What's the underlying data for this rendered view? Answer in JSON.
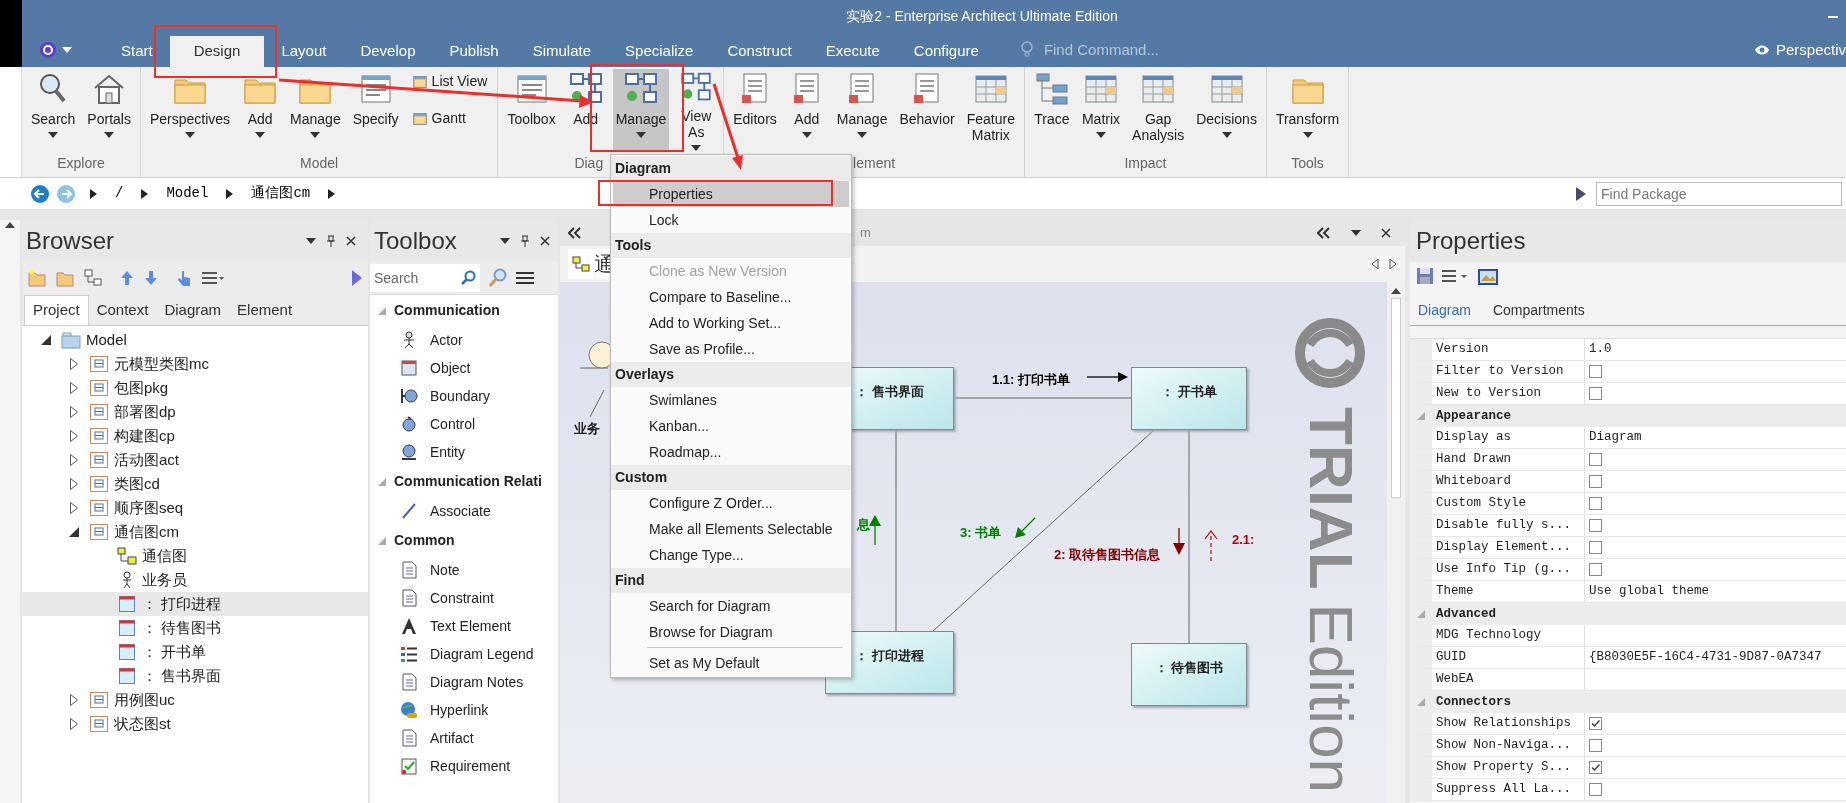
{
  "window": {
    "title": "实验2 - Enterprise Architect Ultimate Edition"
  },
  "ribbon_tabs": [
    {
      "label": "Start",
      "selected": false
    },
    {
      "label": "Design",
      "selected": true
    },
    {
      "label": "Layout",
      "selected": false
    },
    {
      "label": "Develop",
      "selected": false
    },
    {
      "label": "Publish",
      "selected": false
    },
    {
      "label": "Simulate",
      "selected": false
    },
    {
      "label": "Specialize",
      "selected": false
    },
    {
      "label": "Construct",
      "selected": false
    },
    {
      "label": "Execute",
      "selected": false
    },
    {
      "label": "Configure",
      "selected": false
    }
  ],
  "find_command": {
    "placeholder": "Find Command..."
  },
  "perspective": {
    "label": "Perspectiv"
  },
  "ribbon_groups": [
    {
      "label": "Explore",
      "buttons": [
        {
          "label": "Search",
          "kind": "large",
          "dropdown": true,
          "selected": false
        },
        {
          "label": "Portals",
          "kind": "large",
          "dropdown": true,
          "selected": false
        }
      ]
    },
    {
      "label": "Model",
      "buttons": [
        {
          "label": "Perspectives",
          "kind": "large",
          "dropdown": true,
          "selected": false
        },
        {
          "label": "Add",
          "kind": "large",
          "dropdown": true,
          "selected": false
        },
        {
          "label": "Manage",
          "kind": "large",
          "dropdown": true,
          "selected": false
        },
        {
          "label": "Specify",
          "kind": "large",
          "dropdown": false,
          "selected": false
        },
        {
          "label": "List View",
          "kind": "small",
          "dropdown": false,
          "selected": false
        },
        {
          "label": "Gantt",
          "kind": "small",
          "dropdown": false,
          "selected": false
        }
      ]
    },
    {
      "label": "Diag",
      "buttons": [
        {
          "label": "Toolbox",
          "kind": "large",
          "dropdown": false,
          "selected": false
        },
        {
          "label": "Add",
          "kind": "large",
          "dropdown": false,
          "selected": false
        },
        {
          "label": "Manage",
          "kind": "large",
          "dropdown": true,
          "selected": true
        },
        {
          "label": "View As",
          "kind": "large",
          "dropdown": true,
          "selected": false
        }
      ]
    },
    {
      "label": "lement",
      "buttons": [
        {
          "label": "Editors",
          "kind": "large",
          "dropdown": false,
          "selected": false
        },
        {
          "label": "Add",
          "kind": "large",
          "dropdown": true,
          "selected": false
        },
        {
          "label": "Manage",
          "kind": "large",
          "dropdown": true,
          "selected": false
        },
        {
          "label": "Behavior",
          "kind": "large",
          "dropdown": false,
          "selected": false
        },
        {
          "label": "Feature Matrix",
          "kind": "large",
          "dropdown": false,
          "selected": false
        }
      ]
    },
    {
      "label": "Impact",
      "buttons": [
        {
          "label": "Trace",
          "kind": "large",
          "dropdown": false,
          "selected": false
        },
        {
          "label": "Matrix",
          "kind": "large",
          "dropdown": true,
          "selected": false
        },
        {
          "label": "Gap Analysis",
          "kind": "large",
          "dropdown": false,
          "selected": false
        },
        {
          "label": "Decisions",
          "kind": "large",
          "dropdown": true,
          "selected": false
        }
      ]
    },
    {
      "label": "Tools",
      "buttons": [
        {
          "label": "Transform",
          "kind": "large",
          "dropdown": true,
          "selected": false
        }
      ]
    }
  ],
  "breadcrumb": [
    "/",
    "Model",
    "通信图cm"
  ],
  "find_package": {
    "placeholder": "Find Package"
  },
  "browser": {
    "title": "Browser",
    "tabs": [
      {
        "label": "Project",
        "selected": true
      },
      {
        "label": "Context",
        "selected": false
      },
      {
        "label": "Diagram",
        "selected": false
      },
      {
        "label": "Element",
        "selected": false
      }
    ],
    "tree": [
      {
        "label": "Model",
        "kind": "model",
        "expanded": true,
        "selected": false,
        "children": [
          {
            "label": "元模型类图mc",
            "kind": "package",
            "expanded": false,
            "selected": false
          },
          {
            "label": "包图pkg",
            "kind": "package",
            "expanded": false,
            "selected": false
          },
          {
            "label": "部署图dp",
            "kind": "package",
            "expanded": false,
            "selected": false
          },
          {
            "label": "构建图cp",
            "kind": "package",
            "expanded": false,
            "selected": false
          },
          {
            "label": "活动图act",
            "kind": "package",
            "expanded": false,
            "selected": false
          },
          {
            "label": "类图cd",
            "kind": "package",
            "expanded": false,
            "selected": false
          },
          {
            "label": "顺序图seq",
            "kind": "package",
            "expanded": false,
            "selected": false
          },
          {
            "label": "通信图cm",
            "kind": "package",
            "expanded": true,
            "selected": false,
            "children": [
              {
                "label": "通信图",
                "kind": "diagram",
                "selected": false
              },
              {
                "label": "业务员",
                "kind": "actor",
                "selected": false
              },
              {
                "label": "： 打印进程",
                "kind": "object",
                "selected": true
              },
              {
                "label": "： 待售图书",
                "kind": "object",
                "selected": false
              },
              {
                "label": "： 开书单",
                "kind": "object",
                "selected": false
              },
              {
                "label": "： 售书界面",
                "kind": "object",
                "selected": false
              }
            ]
          },
          {
            "label": "用例图uc",
            "kind": "package",
            "expanded": false,
            "selected": false
          },
          {
            "label": "状态图st",
            "kind": "package",
            "expanded": false,
            "selected": false
          }
        ]
      }
    ]
  },
  "toolbox": {
    "title": "Toolbox",
    "search": {
      "placeholder": "Search"
    },
    "sections": [
      {
        "title": "Communication",
        "expanded": true,
        "items": [
          "Actor",
          "Object",
          "Boundary",
          "Control",
          "Entity"
        ]
      },
      {
        "title": "Communication Relati",
        "expanded": true,
        "items": [
          "Associate"
        ]
      },
      {
        "title": "Common",
        "expanded": true,
        "items": [
          "Note",
          "Constraint",
          "Text Element",
          "Diagram Legend",
          "Diagram Notes",
          "Hyperlink",
          "Artifact",
          "Requirement"
        ]
      }
    ]
  },
  "diagram": {
    "title": "m",
    "tab": "通",
    "actor": "业务",
    "nodes": [
      {
        "label": "： 售书界面"
      },
      {
        "label": "： 开书单"
      },
      {
        "label": "： 打印进程"
      },
      {
        "label": "： 待售图书"
      }
    ],
    "messages": [
      {
        "label": "1.1: 打印书单",
        "color": "#000000"
      },
      {
        "label": "3: 书单",
        "color": "#008000"
      },
      {
        "label": "2: 取待售图书信息",
        "color": "#800000"
      },
      {
        "label": "2.1:",
        "color": "#c00000"
      },
      {
        "label": "息",
        "color": "#008000"
      }
    ],
    "watermark": [
      "TRIAL",
      "Edition"
    ]
  },
  "menu": {
    "sections": [
      {
        "title": "Diagram",
        "items": [
          {
            "label": "Properties",
            "selected": true,
            "disabled": false
          },
          {
            "label": "Lock",
            "selected": false,
            "disabled": false
          }
        ]
      },
      {
        "title": "Tools",
        "items": [
          {
            "label": "Clone as New Version",
            "selected": false,
            "disabled": true
          },
          {
            "label": "Compare to Baseline...",
            "selected": false,
            "disabled": false
          },
          {
            "label": "Add to Working Set...",
            "selected": false,
            "disabled": false
          },
          {
            "label": "Save as Profile...",
            "selected": false,
            "disabled": false
          }
        ]
      },
      {
        "title": "Overlays",
        "items": [
          {
            "label": "Swimlanes",
            "selected": false,
            "disabled": false
          },
          {
            "label": "Kanban...",
            "selected": false,
            "disabled": false
          },
          {
            "label": "Roadmap...",
            "selected": false,
            "disabled": false
          }
        ]
      },
      {
        "title": "Custom",
        "items": [
          {
            "label": "Configure Z Order...",
            "selected": false,
            "disabled": false
          },
          {
            "label": "Make all Elements Selectable",
            "selected": false,
            "disabled": false
          },
          {
            "label": "Change Type...",
            "selected": false,
            "disabled": false
          }
        ]
      },
      {
        "title": "Find",
        "items": [
          {
            "label": "Search for Diagram",
            "selected": false,
            "disabled": false,
            "separator_before": false
          },
          {
            "label": "Browse for Diagram",
            "selected": false,
            "disabled": false,
            "separator_before": false
          },
          {
            "label": "Set as My Default",
            "selected": false,
            "disabled": false,
            "separator_before": true
          }
        ]
      }
    ]
  },
  "properties": {
    "title": "Properties",
    "tabs": [
      {
        "label": "Diagram",
        "selected": true
      },
      {
        "label": "Compartments",
        "selected": false
      }
    ],
    "sections": [
      {
        "rows": [
          {
            "label": "Version",
            "kind": "text",
            "value": "1.0"
          },
          {
            "label": "Filter to Version",
            "kind": "checkbox",
            "checked": false
          },
          {
            "label": "New to Version",
            "kind": "checkbox",
            "checked": false
          }
        ]
      },
      {
        "title": "Appearance",
        "expanded": true,
        "rows": [
          {
            "label": "Display as",
            "kind": "text",
            "value": "Diagram"
          },
          {
            "label": "Hand Drawn",
            "kind": "checkbox",
            "checked": false
          },
          {
            "label": "Whiteboard",
            "kind": "checkbox",
            "checked": false
          },
          {
            "label": "Custom Style",
            "kind": "checkbox",
            "checked": false
          },
          {
            "label": "Disable fully s...",
            "kind": "checkbox",
            "checked": false
          },
          {
            "label": "Display Element...",
            "kind": "checkbox",
            "checked": false
          },
          {
            "label": "Use Info Tip (g...",
            "kind": "checkbox",
            "checked": false
          },
          {
            "label": "Theme",
            "kind": "text",
            "value": "Use global theme"
          }
        ]
      },
      {
        "title": "Advanced",
        "expanded": true,
        "rows": [
          {
            "label": "MDG Technology",
            "kind": "text"
          },
          {
            "label": "GUID",
            "kind": "text",
            "value": "{B8030E5F-16C4-4731-9D87-0A7347"
          },
          {
            "label": "WebEA",
            "kind": "text"
          }
        ]
      },
      {
        "title": "Connectors",
        "expanded": true,
        "rows": [
          {
            "label": "Show Relationships",
            "kind": "checkbox",
            "checked": true
          },
          {
            "label": "Show Non-Naviga...",
            "kind": "checkbox",
            "checked": false
          },
          {
            "label": "Show Property S...",
            "kind": "checkbox",
            "checked": true
          },
          {
            "label": "Suppress All La...",
            "kind": "checkbox",
            "checked": false
          }
        ]
      }
    ]
  }
}
